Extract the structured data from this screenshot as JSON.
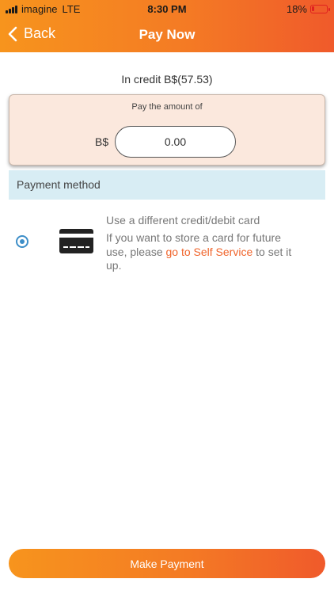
{
  "status_bar": {
    "carrier": "imagine",
    "network": "LTE",
    "time": "8:30 PM",
    "battery": "18%",
    "battery_level": 0.18
  },
  "header": {
    "back_label": "Back",
    "title": "Pay Now"
  },
  "credit_text": "In credit B$(57.53)",
  "pay": {
    "label": "Pay the amount of",
    "currency": "B$",
    "amount": "0.00"
  },
  "payment_method": {
    "header": "Payment method",
    "option": {
      "title": "Use a different credit/debit card",
      "desc_prefix": "If you want to store a card for future use, please ",
      "link_text": "go to Self Service",
      "desc_suffix": " to set it up.",
      "selected": true
    }
  },
  "make_payment_label": "Make Payment",
  "colors": {
    "accent_start": "#f7941d",
    "accent_end": "#f05a2b",
    "link": "#f0642b",
    "radio": "#3d8ec8",
    "method_header_bg": "#d8edf4",
    "paybox_bg": "#fbe8dd"
  }
}
